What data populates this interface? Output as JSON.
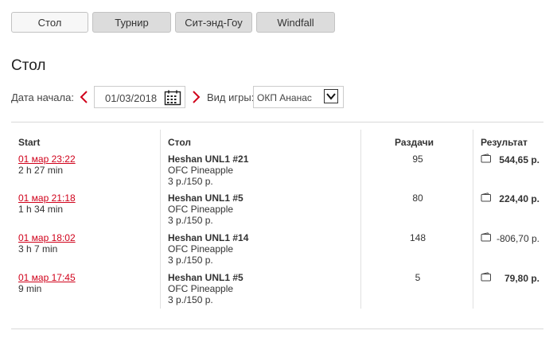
{
  "tabs": [
    {
      "label": "Стол",
      "active": true
    },
    {
      "label": "Турнир",
      "active": false
    },
    {
      "label": "Сит-энд-Гоу",
      "active": false
    },
    {
      "label": "Windfall",
      "active": false
    }
  ],
  "section_title": "Стол",
  "filters": {
    "date_label": "Дата начала:",
    "date_value": "01/03/2018",
    "game_label": "Вид игры:",
    "game_value": "ОКП Ананас"
  },
  "table": {
    "headers": {
      "start": "Start",
      "table": "Стол",
      "hands": "Раздачи",
      "result": "Результат"
    },
    "rows": [
      {
        "start": "01 мар 23:22",
        "duration": "2 h 27 min",
        "table_name": "Heshan UNL1 #21",
        "game": "OFC Pineapple",
        "stakes": "3 р./150 р.",
        "hands": "95",
        "result": "544,65 р."
      },
      {
        "start": "01 мар 21:18",
        "duration": "1 h 34 min",
        "table_name": "Heshan UNL1 #5",
        "game": "OFC Pineapple",
        "stakes": "3 р./150 р.",
        "hands": "80",
        "result": "224,40 р."
      },
      {
        "start": "01 мар 18:02",
        "duration": "3 h 7 min",
        "table_name": "Heshan UNL1 #14",
        "game": "OFC Pineapple",
        "stakes": "3 р./150 р.",
        "hands": "148",
        "result": "-806,70 р."
      },
      {
        "start": "01 мар 17:45",
        "duration": "9 min",
        "table_name": "Heshan UNL1 #5",
        "game": "OFC Pineapple",
        "stakes": "3 р./150 р.",
        "hands": "5",
        "result": "79,80 р."
      }
    ]
  },
  "colors": {
    "accent": "#d0021b",
    "border": "#d9d9d9"
  }
}
